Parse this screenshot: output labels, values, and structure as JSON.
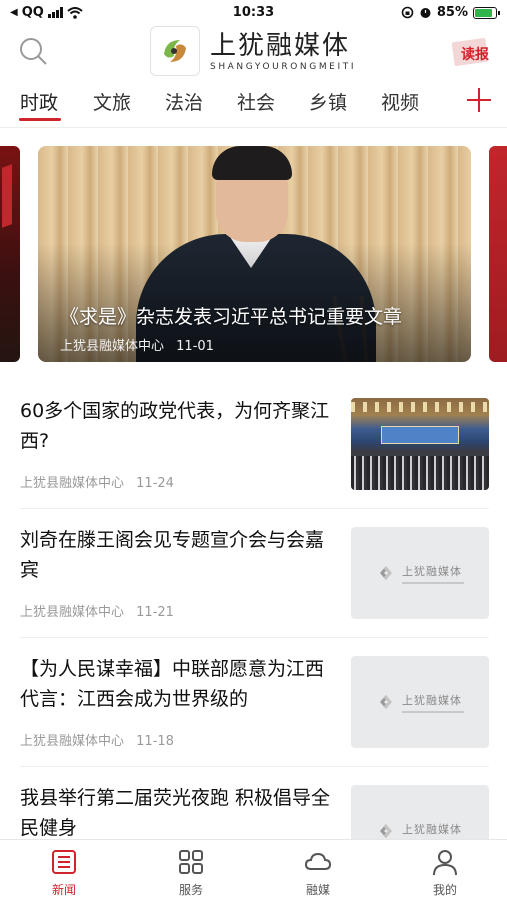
{
  "status_bar": {
    "carrier": "QQ",
    "time": "10:33",
    "battery_percent": "85%",
    "battery_level": 0.85
  },
  "header": {
    "app_name": "上犹融媒体",
    "app_name_pinyin": "SHANGYOURONGMEITI",
    "read_paper_label": "读报"
  },
  "tabs": [
    {
      "label": "时政",
      "active": true
    },
    {
      "label": "文旅",
      "active": false
    },
    {
      "label": "法治",
      "active": false
    },
    {
      "label": "社会",
      "active": false
    },
    {
      "label": "乡镇",
      "active": false
    },
    {
      "label": "视频",
      "active": false
    }
  ],
  "carousel": {
    "title": "《求是》杂志发表习近平总书记重要文章",
    "source": "上犹县融媒体中心",
    "date": "11-01"
  },
  "news": [
    {
      "title": "60多个国家的政党代表，为何齐聚江西?",
      "source": "上犹县融媒体中心",
      "date": "11-24",
      "thumb": "photo"
    },
    {
      "title": "刘奇在滕王阁会见专题宣介会与会嘉宾",
      "source": "上犹县融媒体中心",
      "date": "11-21",
      "thumb": "placeholder"
    },
    {
      "title": "【为人民谋幸福】中联部愿意为江西代言：江西会成为世界级的",
      "source": "上犹县融媒体中心",
      "date": "11-18",
      "thumb": "placeholder"
    },
    {
      "title": "我县举行第二届荧光夜跑 积极倡导全民健身",
      "source": "",
      "date": "",
      "thumb": "placeholder"
    }
  ],
  "thumb_placeholder_text": "上犹融媒体",
  "bottom_nav": [
    {
      "label": "新闻",
      "icon": "news-icon",
      "active": true
    },
    {
      "label": "服务",
      "icon": "grid-icon",
      "active": false
    },
    {
      "label": "融媒",
      "icon": "cloud-icon",
      "active": false
    },
    {
      "label": "我的",
      "icon": "user-icon",
      "active": false
    }
  ],
  "colors": {
    "accent": "#d0232c",
    "meta_text": "#9a9a9a",
    "battery_fill": "#2fb54a"
  }
}
